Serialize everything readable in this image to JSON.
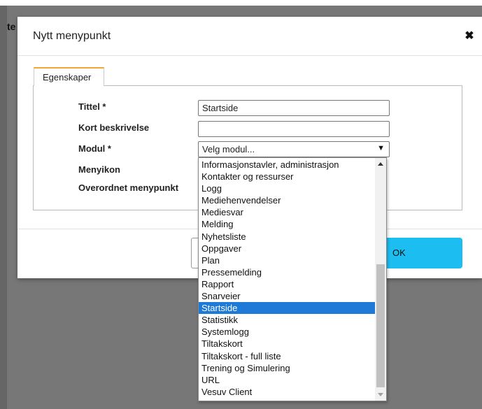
{
  "background": {
    "fragment_top": "te",
    "fragment_bottom": ""
  },
  "dialog": {
    "title": "Nytt menypunkt",
    "close_icon": "close-icon",
    "tab_label": "Egenskaper",
    "fields": {
      "tittel_label": "Tittel *",
      "tittel_value": "Startside",
      "kort_label": "Kort beskrivelse",
      "kort_value": "",
      "modul_label": "Modul *",
      "modul_value": "Velg modul...",
      "menyikon_label": "Menyikon",
      "overordnet_label": "Overordnet menypunkt"
    },
    "ok_label": "OK",
    "accent_color": "#1cbdf0",
    "tab_accent": "#f0a832"
  },
  "dropdown": {
    "selected": "Startside",
    "items": [
      "Informasjonstavler, administrasjon",
      "Kontakter og ressurser",
      "Logg",
      "Mediehenvendelser",
      "Mediesvar",
      "Melding",
      "Nyhetsliste",
      "Oppgaver",
      "Plan",
      "Pressemelding",
      "Rapport",
      "Snarveier",
      "Startside",
      "Statistikk",
      "Systemlogg",
      "Tiltakskort",
      "Tiltakskort - full liste",
      "Trening og Simulering",
      "URL",
      "Vesuv Client"
    ]
  }
}
